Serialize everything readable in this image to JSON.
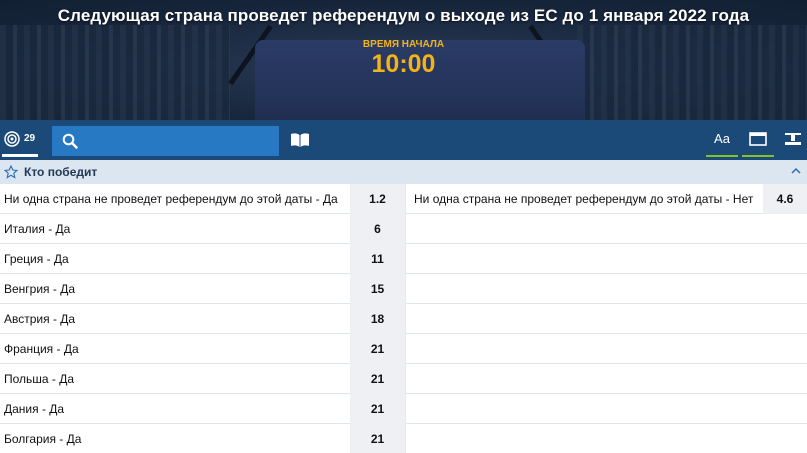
{
  "banner": {
    "title": "Следующая страна проведет референдум о выходе из ЕС до 1 января 2022 года",
    "start_label": "ВРЕМЯ НАЧАЛА",
    "start_time": "10:00"
  },
  "toolbar": {
    "count": "29",
    "icons": [
      "target-icon",
      "search-icon",
      "book-icon",
      "font-size-icon",
      "window-icon",
      "pin-icon"
    ],
    "font_icon_text": "Aa",
    "accent_color": "#85c226"
  },
  "market": {
    "title": "Кто победит"
  },
  "outcomes": [
    {
      "name": "Ни одна страна не проведет референдум до этой даты - Да",
      "odd": "1.2",
      "name2": "Ни одна страна не проведет референдум до этой даты - Нет",
      "odd2": "4.6"
    },
    {
      "name": "Италия - Да",
      "odd": "6"
    },
    {
      "name": "Греция - Да",
      "odd": "11"
    },
    {
      "name": "Венгрия - Да",
      "odd": "15"
    },
    {
      "name": "Австрия - Да",
      "odd": "18"
    },
    {
      "name": "Франция - Да",
      "odd": "21"
    },
    {
      "name": "Польша - Да",
      "odd": "21"
    },
    {
      "name": "Дания - Да",
      "odd": "21"
    },
    {
      "name": "Болгария - Да",
      "odd": "21"
    }
  ]
}
